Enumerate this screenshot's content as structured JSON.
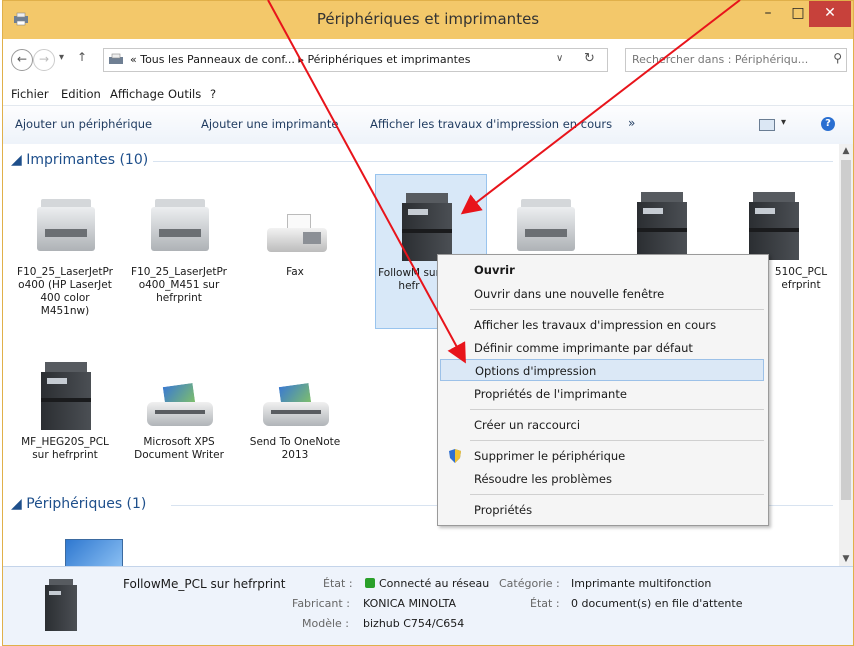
{
  "window": {
    "title": "Périphériques et imprimantes",
    "controls": {
      "minimize": "–",
      "maximize": "□",
      "close": "✕"
    }
  },
  "address": {
    "path": "« Tous les Panneaux de conf...  ▸  Périphériques et imprimantes",
    "search_placeholder": "Rechercher dans : Périphériqu..."
  },
  "menu": [
    "Fichier",
    "Edition",
    "Affichage",
    "Outils",
    "?"
  ],
  "toolbar": {
    "items": [
      "Ajouter un périphérique",
      "Ajouter une imprimante",
      "Afficher les travaux d'impression en cours"
    ],
    "more": "»"
  },
  "groups": {
    "printers": "Imprimantes (10)",
    "devices": "Périphériques (1)"
  },
  "printers": [
    {
      "label": "F10_25_LaserJetPro400 (HP LaserJet 400 color M451nw)"
    },
    {
      "label": "F10_25_LaserJetPro400_M451 sur hefrprint"
    },
    {
      "label": "Fax"
    },
    {
      "label": "FollowMe_PCL sur hefrprint"
    },
    {
      "label": ""
    },
    {
      "label": ""
    },
    {
      "label": "MF_HEG210C_PCL sur hefrprint"
    },
    {
      "label": "MF_HEG20S_PCL sur hefrprint"
    },
    {
      "label": "Microsoft XPS Document Writer"
    },
    {
      "label": "Send To OneNote 2013"
    }
  ],
  "visible_labels": {
    "p0": "F10_25_LaserJetPr o400 (HP LaserJet 400 color M451nw)",
    "p1": "F10_25_LaserJetPr o400_M451 sur hefrprint",
    "p2": "Fax",
    "p3": "FollowM sur hefr",
    "p6": "510C_PCL efrprint",
    "p7": "MF_HEG20S_PCL sur hefrprint",
    "p8": "Microsoft XPS Document Writer",
    "p9": "Send To OneNote 2013"
  },
  "context_menu": {
    "open": "Ouvrir",
    "open_new": "Ouvrir dans une nouvelle fenêtre",
    "show_jobs": "Afficher les travaux d'impression en cours",
    "set_default": "Définir comme imprimante par défaut",
    "print_options": "Options d'impression",
    "printer_props": "Propriétés de l'imprimante",
    "shortcut": "Créer un raccourci",
    "remove": "Supprimer le périphérique",
    "troubleshoot": "Résoudre les problèmes",
    "properties": "Propriétés"
  },
  "details": {
    "name": "FollowMe_PCL sur hefrprint",
    "state_label": "État :",
    "state_value": "Connecté au réseau",
    "category_label": "Catégorie :",
    "category_value": "Imprimante multifonction",
    "maker_label": "Fabricant :",
    "maker_value": "KONICA MINOLTA",
    "state2_label": "État :",
    "state2_value": "0 document(s) en file d'attente",
    "model_label": "Modèle :",
    "model_value": "bizhub C754/C654"
  },
  "colors": {
    "titlebar": "#f3c86a",
    "close_button": "#c7413b",
    "annotation_arrow": "#e8141b",
    "selection": "#d8e8f8"
  }
}
